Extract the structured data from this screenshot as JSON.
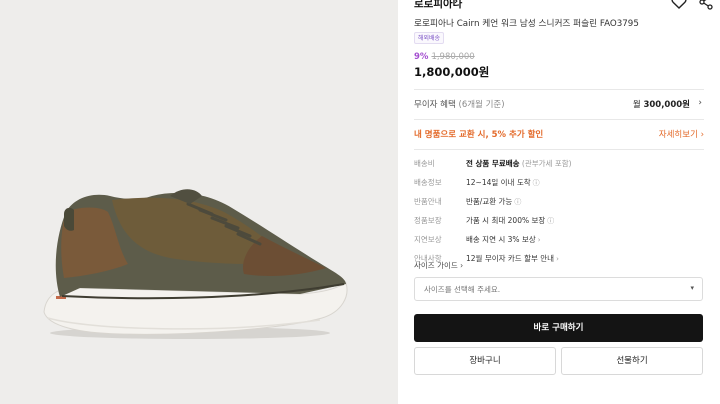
{
  "product": {
    "brand": "로로피아나",
    "brand_chevron": "›",
    "title": "로로피아나 Cairn 케언 워크 남성 스니커즈 퍼슬린 FAO3795",
    "badge": "해외배송",
    "discount": "9%",
    "original_price": "1,980,000",
    "price": "1,800,000원",
    "image_alt": "olive brown sneaker with white sole"
  },
  "actions": {
    "heart_icon": "heart-outline-icon",
    "share_icon": "share-icon"
  },
  "benefit": {
    "label": "무이자 혜택",
    "sub": "(6개월 기준)",
    "prefix": "월",
    "amount": "300,000원",
    "chevron": "›"
  },
  "promo": {
    "label": "내 명품으로 교환 시, 5% 추가 할인",
    "link": "자세히보기 ›"
  },
  "info": [
    {
      "key": "배송비",
      "value": "전 상품 무료배송",
      "note": "(관부가세 포함)",
      "icon": ""
    },
    {
      "key": "배송정보",
      "value": "12~14일 이내 도착",
      "note": "",
      "icon": "ⓘ"
    },
    {
      "key": "반품안내",
      "value": "반품/교환 가능",
      "note": "",
      "icon": "ⓘ"
    },
    {
      "key": "정품보장",
      "value": "가품 시 최대 200% 보장",
      "note": "",
      "icon": "ⓘ"
    },
    {
      "key": "지연보상",
      "value": "배송 지연 시 3% 보상",
      "note": "",
      "icon": "›"
    },
    {
      "key": "안내사항",
      "value": "12월 무이자 카드 할부 안내",
      "note": "",
      "icon": "›"
    }
  ],
  "size": {
    "guide_label": "사이즈 가이드 ›",
    "select_placeholder": "사이즈를 선택해 주세요.",
    "caret": "▾"
  },
  "buttons": {
    "buy": "바로 구매하기",
    "cart": "장바구니",
    "gift": "선물하기"
  },
  "colors": {
    "gallery_bg": "#eeedeb",
    "primary_button": "#141414",
    "accent_promo": "#e36a2a",
    "discount": "#a44fd0"
  }
}
